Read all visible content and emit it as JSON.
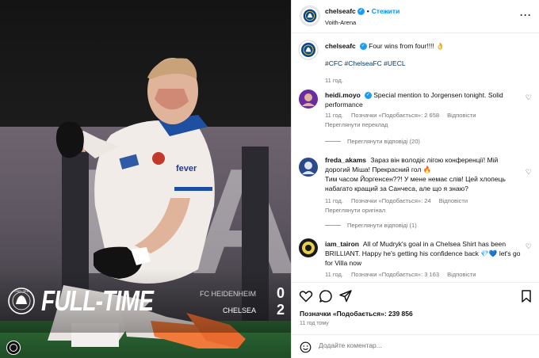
{
  "post_photo": {
    "overlay_title": "FULL-TIME",
    "scores": [
      {
        "team": "FC HEIDENHEIM",
        "score": "0"
      },
      {
        "team": "CHELSEA",
        "score": "2"
      }
    ],
    "sponsor": "fever"
  },
  "header": {
    "username": "chelseafc",
    "follow_label": "Стежити",
    "location": "Voith-Arena",
    "more_icon": "more-horizontal-icon"
  },
  "caption": {
    "username": "chelseafc",
    "text": "Four wins from four!!!! 👌",
    "hashtags": "#CFC #ChelseaFC #UECL",
    "time": "11 год."
  },
  "comments": [
    {
      "username": "heidi.moyo",
      "verified": true,
      "text": "Special mention to Jorgensen tonight. Solid performance",
      "time": "11 год.",
      "likes": "Позначки «Подобається»: 2 658",
      "reply": "Відповісти",
      "translate": "Переглянути переклад",
      "view_replies": "Переглянути відповіді (20)",
      "avatar_color": "#6a2ca0"
    },
    {
      "username": "freda_akams",
      "verified": false,
      "text": "Зараз він володіє лігою конференції! Мій дорогий Міша! Прекрасний гол 🔥",
      "text2": "Тим часом Йоргенсен??! У мене немає слів! Цей хлопець набагато кращий за Санчеса, але що я знаю?",
      "time": "11 год.",
      "likes": "Позначки «Подобається»: 24",
      "reply": "Відповісти",
      "translate": "Переглянути оригінал",
      "view_replies": "Переглянути відповіді (1)",
      "avatar_color": "#2a4a8a"
    },
    {
      "username": "iam_tairon",
      "verified": false,
      "text": "All of Mudryk's goal in a Chelsea Shirt has been BRILLIANT. Happy he's getting his confidence back 💎💙 let's go for Villa now",
      "time": "11 год.",
      "likes": "Позначки «Подобається»: 3 163",
      "reply": "Відповісти",
      "avatar_color": "#1a1a1a"
    }
  ],
  "actions": {
    "likes": "Позначки «Подобається»: 239 856",
    "time_ago": "11 год тому",
    "add_comment_placeholder": "Додайте коментар..."
  },
  "colors": {
    "chelsea_blue": "#034694",
    "link_blue": "#0095f6",
    "verified": "#1d9bf0",
    "muted": "#737373"
  }
}
